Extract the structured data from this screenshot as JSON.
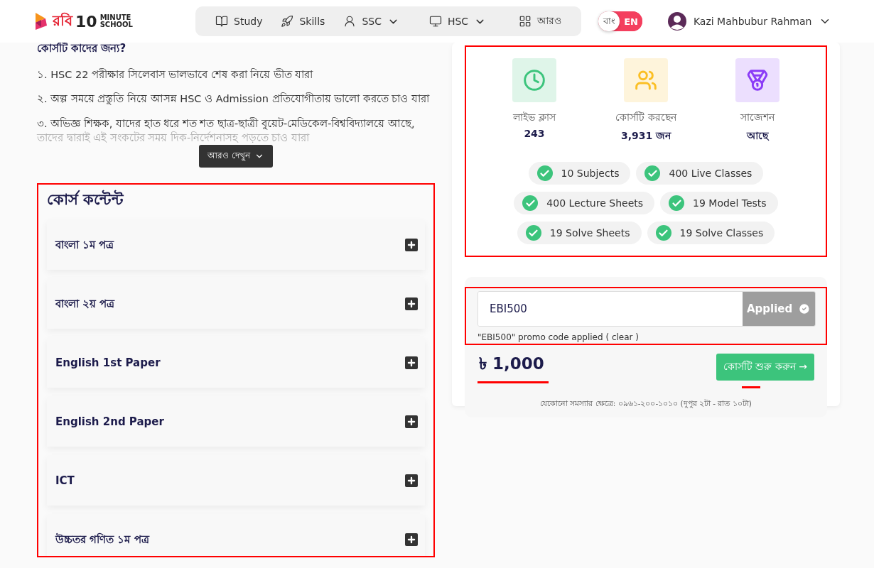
{
  "header": {
    "logo": {
      "bangla": "রবি",
      "brand_number": "10",
      "brand_top": "MINUTE",
      "brand_bottom": "SCHOOL"
    },
    "nav": [
      {
        "label": "Study",
        "dropdown": false
      },
      {
        "label": "Skills",
        "dropdown": false
      },
      {
        "label": "SSC",
        "dropdown": true
      },
      {
        "label": "HSC",
        "dropdown": true
      },
      {
        "label": "আরও",
        "dropdown": false
      }
    ],
    "language": [
      {
        "label": "বাং",
        "selected": false
      },
      {
        "label": "EN",
        "selected": true
      }
    ],
    "user": {
      "name": "Kazi Mahbubur Rahman"
    }
  },
  "audience": {
    "heading": "কোর্সটি কাদের জন্য?",
    "points": [
      {
        "text": "১. HSC 22 পরীক্ষার সিলেবাস ভালভাবে শেষ করা নিয়ে ভীত যারা",
        "faded": false
      },
      {
        "text": "২. অল্প সময়ে প্রস্তুতি নিয়ে আসন্ন HSC ও Admission প্রতিযোগীতায় ভালো করতে চাও যারা",
        "faded": false
      },
      {
        "text": "৩. অভিজ্ঞ শিক্ষক, যাদের হাত ধরে শত শত ছাত্র-ছাত্রী বুয়েট-মেডিকেল-বিশ্ববিদ্যালয়ে আছে,",
        "faded": false
      },
      {
        "text": "তাদের দ্বারাই এই সংকটের সময় দিক-নির্দেশনাসহ পড়তে চাও যারা",
        "faded": true
      }
    ],
    "more_button": "আরও দেখুন"
  },
  "course_content": {
    "title": "কোর্স কন্টেন্ট",
    "sections": [
      {
        "title": "বাংলা ১ম পত্র",
        "expanded": false
      },
      {
        "title": "বাংলা ২য় পত্র",
        "expanded": false
      },
      {
        "title": "English 1st Paper",
        "expanded": false
      },
      {
        "title": "English 2nd Paper",
        "expanded": false
      },
      {
        "title": "ICT",
        "expanded": false
      },
      {
        "title": "উচ্চতর গণিত ১ম পত্র",
        "expanded": false
      }
    ]
  },
  "stats": [
    {
      "label": "লাইভ ক্লাস",
      "value": "243",
      "color": "#3cc47c"
    },
    {
      "label": "কোর্সটি করছেন",
      "value": "3,931 জন",
      "color": "#fbbf24"
    },
    {
      "label": "সাজেশন",
      "value": "আছে",
      "color": "#8b3cf7"
    }
  ],
  "features": [
    [
      "10 Subjects",
      "400 Live Classes"
    ],
    [
      "400 Lecture Sheets",
      "19 Model Tests"
    ],
    [
      "19 Solve Sheets",
      "19 Solve Classes"
    ]
  ],
  "promo": {
    "value": "EBI500",
    "button": "Applied",
    "applied": true,
    "note": "\"EBI500\" promo code applied ( clear )"
  },
  "price": "৳ 1,000",
  "cta": "কোর্সটি শুরু করুন →",
  "helpline": "যেকোনো সমস্যার ক্ষেত্রে: ০৯৬১-২০০-১০১০ (দুপুর ২টা - রাত ১০টা)"
}
